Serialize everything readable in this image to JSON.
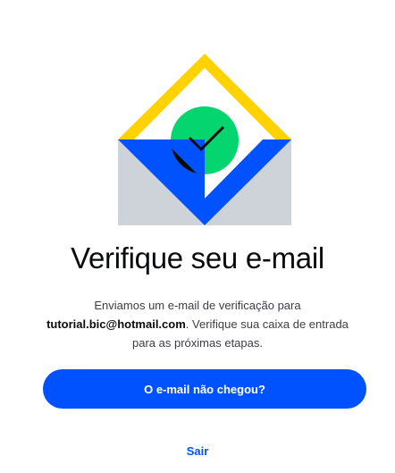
{
  "illustration": {
    "name": "email-envelope-check-icon",
    "colors": {
      "yellow": "#ffd200",
      "blue": "#0052ff",
      "green": "#05d56f",
      "gray": "#ced2d9",
      "black": "#0a0b0d"
    }
  },
  "title": "Verifique seu e-mail",
  "description": {
    "before": "Enviamos um e-mail de verificação para",
    "email": "tutorial.bic@hotmail.com",
    "after": ". Verifique sua caixa de entrada para as próximas etapas."
  },
  "actions": {
    "resend_label": "O e-mail não chegou?",
    "logout_label": "Sair"
  },
  "colors": {
    "accent": "#0052ff",
    "text": "#0a0b0d",
    "muted": "#3c3e44"
  }
}
